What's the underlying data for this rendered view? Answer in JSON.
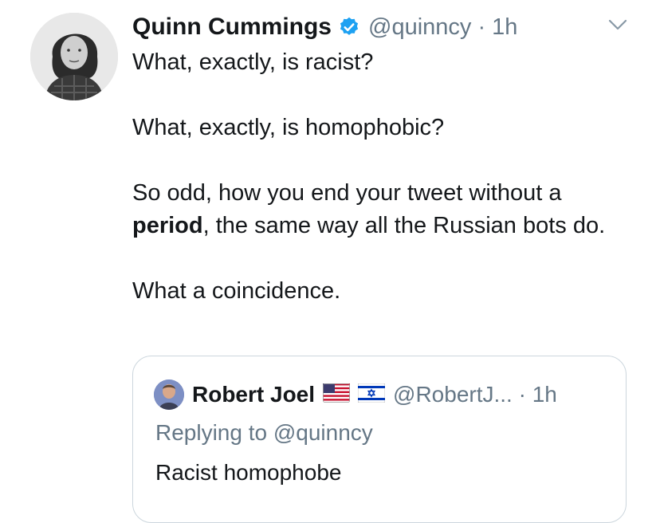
{
  "tweet": {
    "author_name": "Quinn Cummings",
    "handle_time": "@quinncy · 1h",
    "paragraphs": [
      "What, exactly, is racist?",
      "What, exactly, is homophobic?",
      "So odd, how you end your tweet without a",
      "the same way all the Russian bots do.",
      "What a coincidence."
    ],
    "bold_word": "period",
    "after_bold": ","
  },
  "quoted": {
    "author_name": "Robert Joel",
    "handle_time": "@RobertJ... · 1h",
    "replying_to": "Replying to @quinncy",
    "text": "Racist homophobe"
  },
  "colors": {
    "text": "#14171a",
    "secondary": "#657786",
    "verified_blue": "#1da1f2",
    "border": "#ccd6dd"
  },
  "icons": [
    "avatar",
    "verified-badge-icon",
    "chevron-down-icon",
    "us-flag-icon",
    "israel-flag-icon"
  ]
}
